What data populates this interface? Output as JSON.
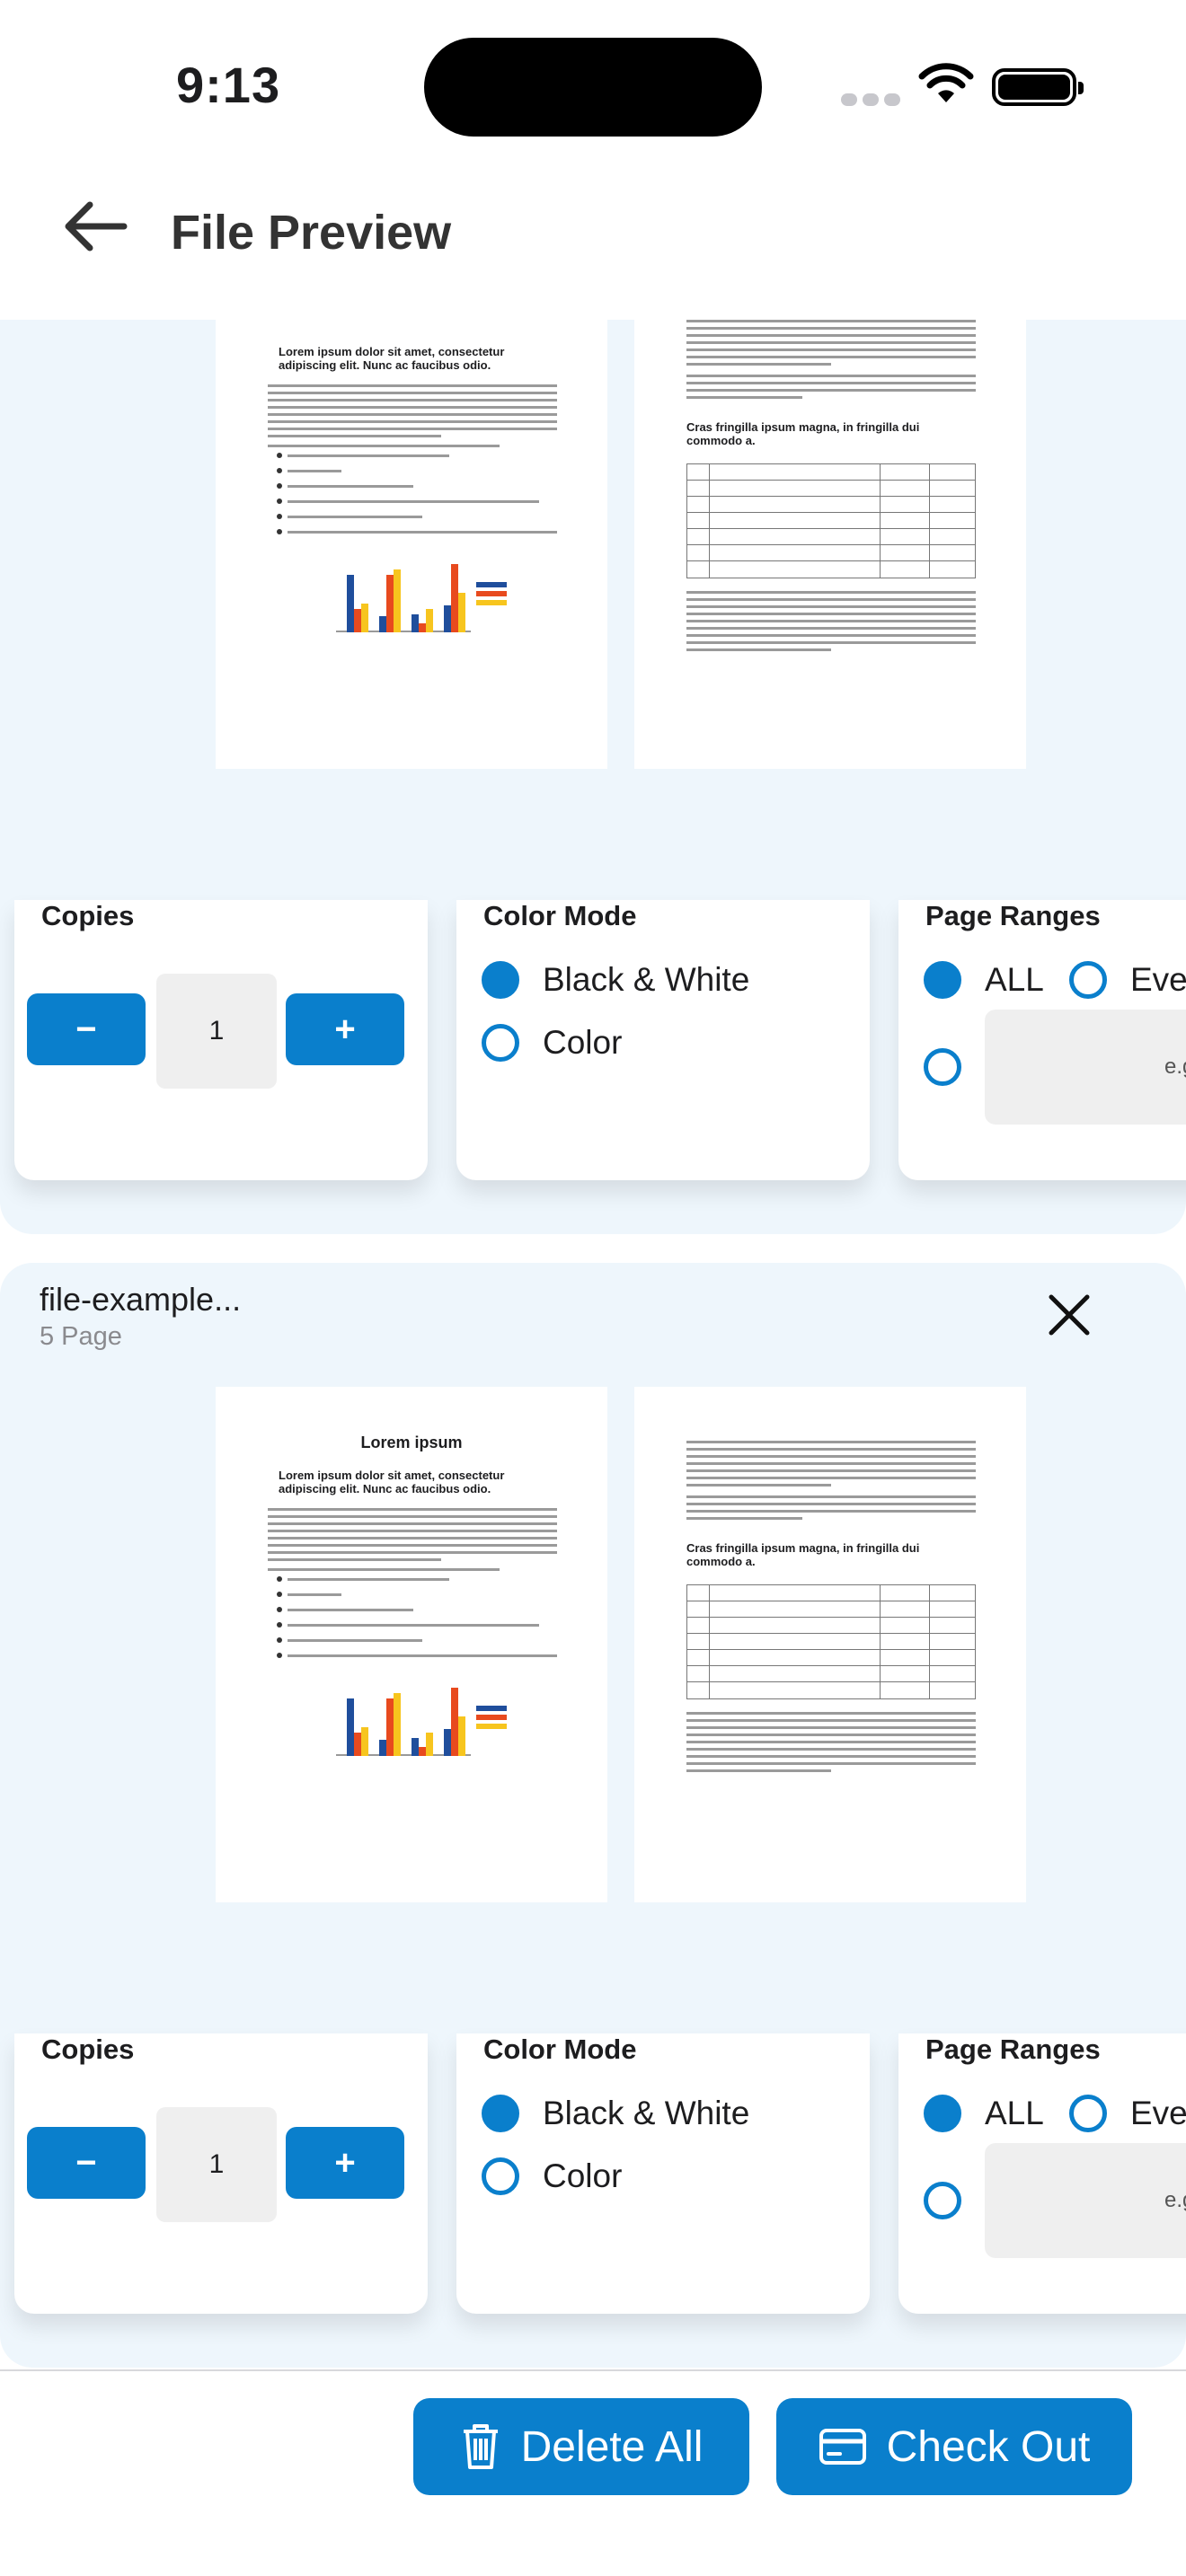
{
  "status": {
    "time": "9:13"
  },
  "header": {
    "title": "File Preview"
  },
  "files": [
    {
      "name": "",
      "pages_label": "",
      "preview": {
        "left_title": "",
        "left_subtitle": "Lorem ipsum dolor sit amet, consectetur adipiscing elit. Nunc ac faucibus odio.",
        "right_subtitle": "Cras fringilla ipsum magna, in fringilla dui commodo a."
      },
      "copies": {
        "label": "Copies",
        "value": "1",
        "minus": "−",
        "plus": "+"
      },
      "color_mode": {
        "label": "Color Mode",
        "options": [
          "Black & White",
          "Color"
        ],
        "selected": "Black & White"
      },
      "page_ranges": {
        "label": "Page Ranges",
        "options": [
          "ALL",
          "Eve"
        ],
        "selected": "ALL",
        "custom_placeholder": "e.g."
      }
    },
    {
      "name": "file-example...",
      "pages_label": "5 Page",
      "preview": {
        "left_title": "Lorem ipsum",
        "left_subtitle": "Lorem ipsum dolor sit amet, consectetur adipiscing elit. Nunc ac faucibus odio.",
        "right_subtitle": "Cras fringilla ipsum magna, in fringilla dui commodo a."
      },
      "copies": {
        "label": "Copies",
        "value": "1",
        "minus": "−",
        "plus": "+"
      },
      "color_mode": {
        "label": "Color Mode",
        "options": [
          "Black & White",
          "Color"
        ],
        "selected": "Black & White"
      },
      "page_ranges": {
        "label": "Page Ranges",
        "options": [
          "ALL",
          "Eve"
        ],
        "selected": "ALL",
        "custom_placeholder": "e.g."
      }
    }
  ],
  "actions": {
    "delete_all": "Delete All",
    "check_out": "Check Out"
  },
  "colors": {
    "accent": "#0a7fcc",
    "card_bg": "#eef6fc"
  },
  "icons": {
    "back": "arrow-left-icon",
    "close": "close-icon",
    "delete": "trash-icon",
    "checkout": "credit-card-icon"
  }
}
